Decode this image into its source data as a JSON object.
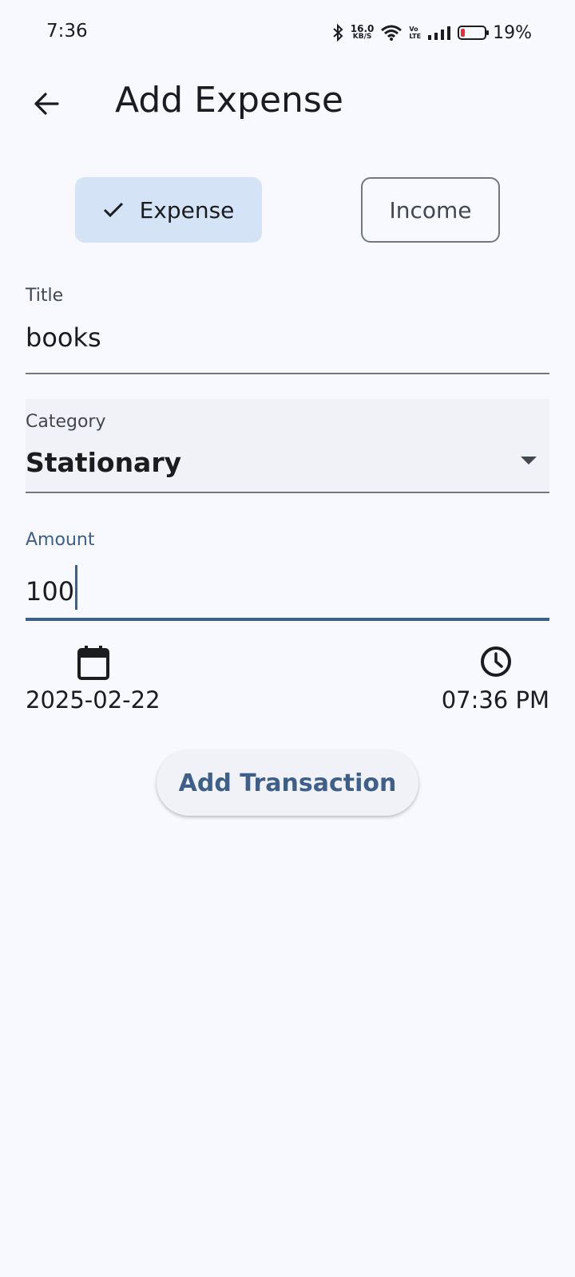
{
  "status_bar": {
    "time": "7:36",
    "net_speed_value": "16.0",
    "net_speed_unit": "KB/S",
    "volte_top": "Vo",
    "volte_bottom": "LTE",
    "battery_percent": "19%",
    "battery_level": 0.19,
    "icons": [
      "bluetooth-icon",
      "wifi-icon",
      "signal-icon",
      "battery-icon"
    ]
  },
  "app_bar": {
    "title": "Add Expense",
    "back_icon": "arrow-left-icon"
  },
  "type_toggle": {
    "expense_label": "Expense",
    "income_label": "Income",
    "selected": "Expense"
  },
  "form": {
    "title_label": "Title",
    "title_value": "books",
    "category_label": "Category",
    "category_value": "Stationary",
    "amount_label": "Amount",
    "amount_value": "100",
    "date_value": "2025-02-22",
    "time_value": "07:36 PM"
  },
  "actions": {
    "add_label": "Add Transaction"
  },
  "colors": {
    "background": "#f7f9fe",
    "accent": "#3d5f8a",
    "selected_segment": "#d5e3f7",
    "battery_low": "#e0303a"
  }
}
